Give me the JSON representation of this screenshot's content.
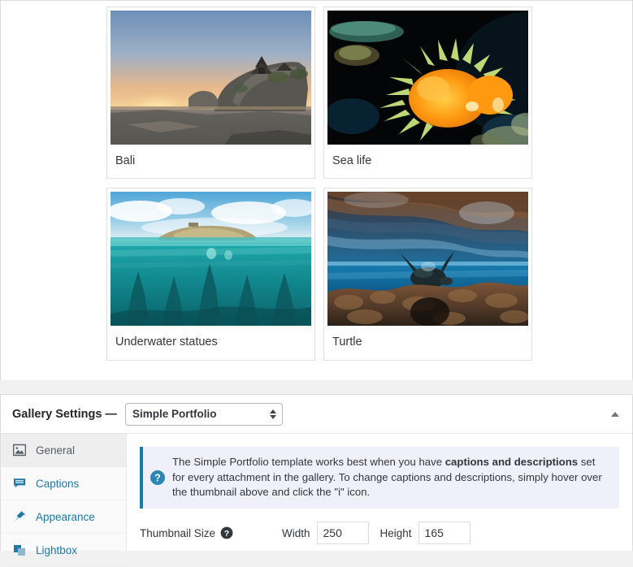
{
  "gallery": {
    "items": [
      {
        "caption": "Bali",
        "image_name": "bali-sunset-temple-thumbnail"
      },
      {
        "caption": "Sea life",
        "image_name": "orange-nudibranch-thumbnail"
      },
      {
        "caption": "Underwater statues",
        "image_name": "underwater-statues-thumbnail"
      },
      {
        "caption": "Turtle",
        "image_name": "sea-turtle-reef-thumbnail"
      }
    ]
  },
  "settings": {
    "title": "Gallery Settings —",
    "template_selected": "Simple Portfolio",
    "template_options": [
      "Simple Portfolio"
    ],
    "collapse_icon": "caret-up-icon",
    "sidebar": [
      {
        "label": "General",
        "icon": "image-icon",
        "active": true
      },
      {
        "label": "Captions",
        "icon": "comment-icon",
        "active": false
      },
      {
        "label": "Appearance",
        "icon": "admin-pin-icon",
        "active": false
      },
      {
        "label": "Lightbox",
        "icon": "lightbox-icon",
        "active": false
      }
    ],
    "notice": {
      "icon": "question-mark-icon",
      "part1": "The Simple Portfolio template works best when you have ",
      "bold": "captions and descriptions",
      "part2": " set for every attachment in the gallery. To change captions and descriptions, simply hover over the thumbnail above and click the \"i\" icon."
    },
    "thumbnail_size": {
      "label": "Thumbnail Size",
      "help_icon": "question-mark-icon",
      "width_label": "Width",
      "width_value": "250",
      "height_label": "Height",
      "height_value": "165"
    }
  },
  "colors": {
    "accent": "#1b7ba6",
    "notice_bg": "#f0f0fb",
    "panel_bg": "#ffffff",
    "page_bg": "#f1f1f1",
    "text": "#32373c"
  }
}
